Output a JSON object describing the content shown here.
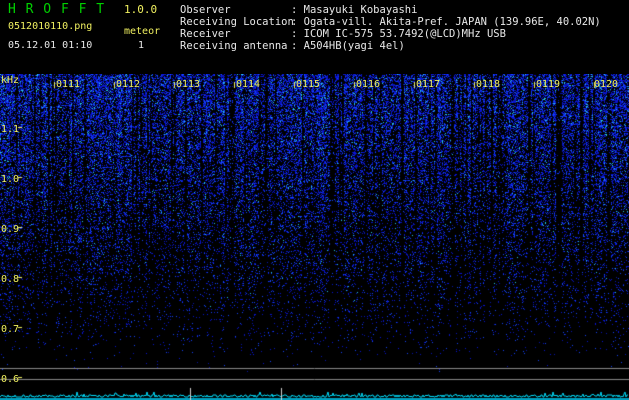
{
  "header": {
    "app_title": "H R O F F T",
    "version": "1.0.0",
    "filename": "0512010110.png",
    "timestamp": "05.12.01 01:10",
    "meteor_label": "meteor",
    "meteor_count": "1",
    "fields": [
      {
        "label": "Observer",
        "value": ": Masayuki Kobayashi"
      },
      {
        "label": "Receiving Location",
        "value": ": Ogata-vill. Akita-Pref. JAPAN (139.96E, 40.02N)"
      },
      {
        "label": "Receiver",
        "value": ": ICOM IC-575 53.7492(@LCD)MHz USB"
      },
      {
        "label": "Receiving antenna",
        "value": ": A504HB(yagi 4el)"
      }
    ]
  },
  "axis": {
    "unit": "kHz",
    "y_ticks": [
      "1.1",
      "1.0",
      "0.9",
      "0.8",
      "0.7",
      "0.6"
    ],
    "x_ticks": [
      "0111",
      "0112",
      "0113",
      "0114",
      "0115",
      "0116",
      "0117",
      "0118",
      "0119",
      "0120"
    ]
  },
  "colors": {
    "background": "#000000",
    "title_green": "#00d000",
    "label_yellow": "#f0f060",
    "spectrum_blue": "#1030ff",
    "spectrum_cyan": "#00e0ff"
  }
}
